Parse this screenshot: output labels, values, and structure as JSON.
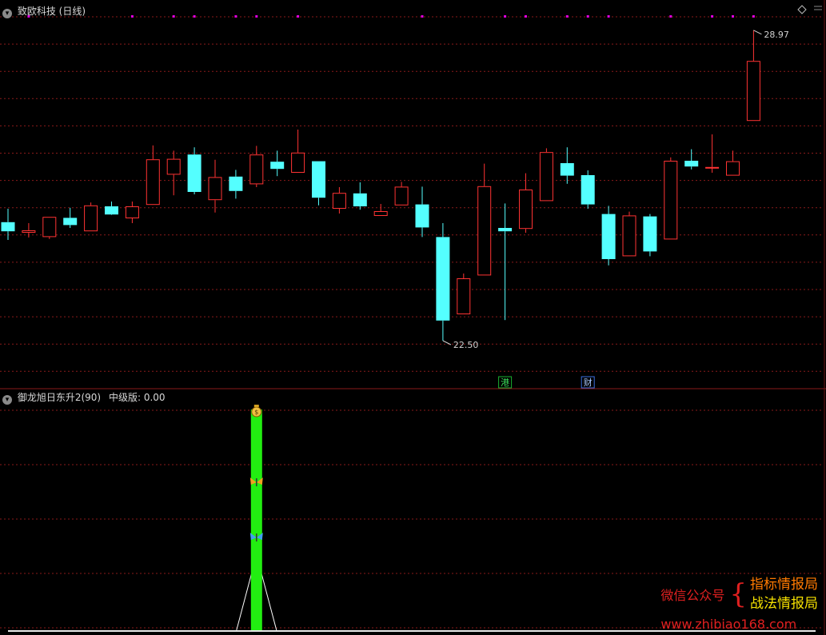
{
  "header": {
    "title": "致欧科技",
    "period": "(日线)",
    "collapse_icon": "chevron-down-icon",
    "top_right_icon": "diamond-icon"
  },
  "indicator": {
    "name": "御龙旭日东升2(90)",
    "field_label": "中级版:",
    "field_value": "0.00"
  },
  "colors": {
    "up": "#ff3333",
    "down": "#54ffff",
    "grid": "#8a1a1a",
    "marker": "#e000e0",
    "bar": "#22ee11",
    "text": "#d8d8d8"
  },
  "chart_data": [
    {
      "type": "candlestick",
      "price_range": [
        21.8,
        29.3
      ],
      "high_label": "28.97",
      "low_label": "22.50",
      "candles": [
        {
          "o": 24.97,
          "h": 25.25,
          "l": 24.6,
          "c": 24.78
        },
        {
          "o": 24.75,
          "h": 24.95,
          "l": 24.65,
          "c": 24.8
        },
        {
          "o": 24.66,
          "h": 25.08,
          "l": 24.62,
          "c": 25.08
        },
        {
          "o": 25.06,
          "h": 25.27,
          "l": 24.85,
          "c": 24.91
        },
        {
          "o": 24.78,
          "h": 25.38,
          "l": 24.78,
          "c": 25.32
        },
        {
          "o": 25.3,
          "h": 25.4,
          "l": 25.12,
          "c": 25.13
        },
        {
          "o": 25.05,
          "h": 25.4,
          "l": 24.95,
          "c": 25.3
        },
        {
          "o": 25.33,
          "h": 26.57,
          "l": 25.33,
          "c": 26.28
        },
        {
          "o": 25.96,
          "h": 26.46,
          "l": 25.53,
          "c": 26.29
        },
        {
          "o": 26.38,
          "h": 26.53,
          "l": 25.55,
          "c": 25.6
        },
        {
          "o": 25.43,
          "h": 26.27,
          "l": 25.17,
          "c": 25.91
        },
        {
          "o": 25.92,
          "h": 26.06,
          "l": 25.46,
          "c": 25.62
        },
        {
          "o": 25.76,
          "h": 26.56,
          "l": 25.7,
          "c": 26.38
        },
        {
          "o": 26.23,
          "h": 26.46,
          "l": 25.93,
          "c": 26.08
        },
        {
          "o": 26.0,
          "h": 26.9,
          "l": 26.0,
          "c": 26.42
        },
        {
          "o": 26.24,
          "h": 26.24,
          "l": 25.32,
          "c": 25.48
        },
        {
          "o": 25.25,
          "h": 25.7,
          "l": 25.15,
          "c": 25.58
        },
        {
          "o": 25.57,
          "h": 25.8,
          "l": 25.23,
          "c": 25.3
        },
        {
          "o": 25.1,
          "h": 25.35,
          "l": 25.1,
          "c": 25.2
        },
        {
          "o": 25.32,
          "h": 25.81,
          "l": 25.32,
          "c": 25.71
        },
        {
          "o": 25.34,
          "h": 25.71,
          "l": 24.66,
          "c": 24.86
        },
        {
          "o": 24.66,
          "h": 24.95,
          "l": 22.5,
          "c": 22.92
        },
        {
          "o": 23.05,
          "h": 23.9,
          "l": 23.05,
          "c": 23.8
        },
        {
          "o": 23.86,
          "h": 26.19,
          "l": 23.86,
          "c": 25.72
        },
        {
          "o": 24.85,
          "h": 25.36,
          "l": 22.93,
          "c": 24.78
        },
        {
          "o": 24.83,
          "h": 25.99,
          "l": 24.75,
          "c": 25.65
        },
        {
          "o": 25.41,
          "h": 26.51,
          "l": 25.41,
          "c": 26.43
        },
        {
          "o": 26.2,
          "h": 26.53,
          "l": 25.77,
          "c": 25.94
        },
        {
          "o": 25.95,
          "h": 26.05,
          "l": 25.25,
          "c": 25.34
        },
        {
          "o": 25.14,
          "h": 25.31,
          "l": 24.07,
          "c": 24.2
        },
        {
          "o": 24.26,
          "h": 25.19,
          "l": 24.26,
          "c": 25.11
        },
        {
          "o": 25.09,
          "h": 25.14,
          "l": 24.26,
          "c": 24.36
        },
        {
          "o": 24.61,
          "h": 26.32,
          "l": 24.61,
          "c": 26.25
        },
        {
          "o": 26.25,
          "h": 26.49,
          "l": 26.07,
          "c": 26.13
        },
        {
          "o": 26.1,
          "h": 26.8,
          "l": 26.0,
          "c": 26.12
        },
        {
          "o": 25.94,
          "h": 26.46,
          "l": 25.94,
          "c": 26.24
        },
        {
          "o": 27.08,
          "h": 28.97,
          "l": 27.08,
          "c": 28.33
        }
      ],
      "event_marks": [
        {
          "index": 24,
          "text": "港"
        },
        {
          "index": 28,
          "text": "财"
        }
      ],
      "top_dot_indices": [
        1,
        6,
        8,
        9,
        11,
        12,
        14,
        20,
        24,
        25,
        27,
        28,
        29,
        32,
        34,
        35,
        36
      ]
    },
    {
      "type": "bar",
      "ylim": [
        0,
        100
      ],
      "signal_index": 12,
      "bar_value": 100,
      "markers": [
        {
          "icon": "money-bag-icon",
          "level": 100
        },
        {
          "icon": "butterfly-icon",
          "level": 67
        },
        {
          "icon": "butterfly-icon",
          "level": 42
        }
      ]
    }
  ],
  "watermark": {
    "wechat": "微信公众号",
    "line1": "指标情报局",
    "line2": "战法情报局",
    "url": "www.zhibiao168.com"
  }
}
